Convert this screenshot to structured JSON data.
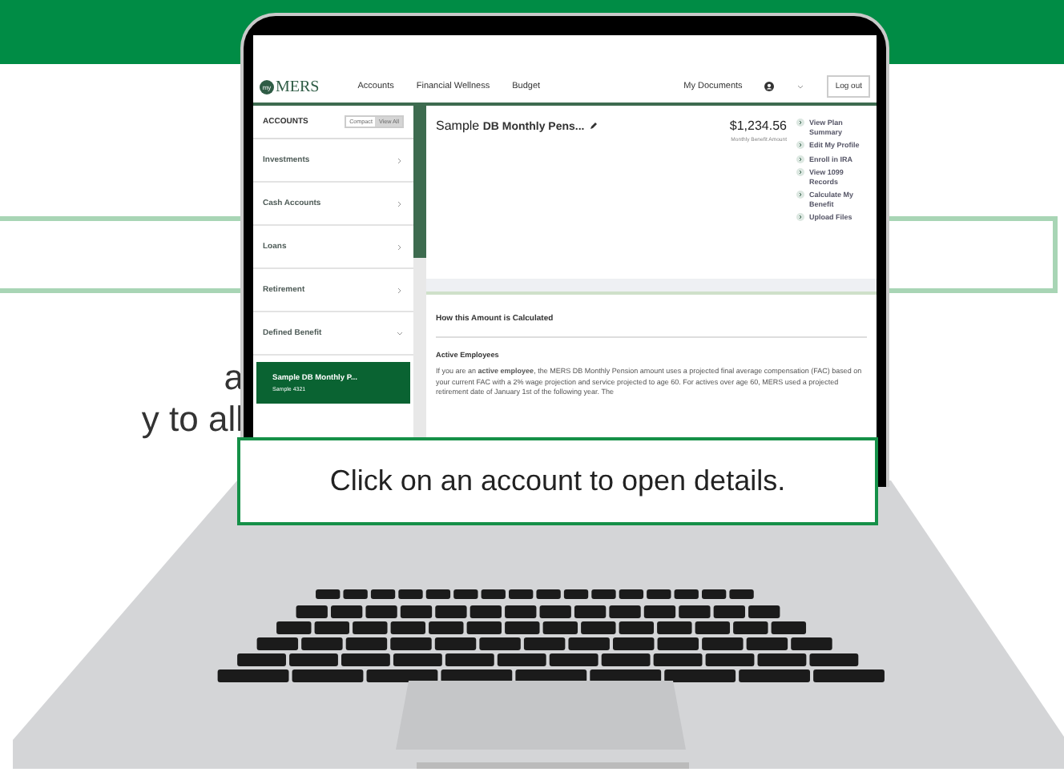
{
  "background_text": [
    "a",
    "y to all"
  ],
  "nav": {
    "logo_mark": "my",
    "logo": "MERS",
    "links": [
      "Accounts",
      "Financial Wellness",
      "Budget"
    ],
    "documents": "My Documents",
    "logout": "Log out"
  },
  "sidebar": {
    "title": "ACCOUNTS",
    "toggle": [
      {
        "label": "Compact",
        "selected": false
      },
      {
        "label": "View All",
        "selected": true
      }
    ],
    "items": [
      {
        "label": "Investments",
        "expanded": false
      },
      {
        "label": "Cash Accounts",
        "expanded": false
      },
      {
        "label": "Loans",
        "expanded": false
      },
      {
        "label": "Retirement",
        "expanded": false
      },
      {
        "label": "Defined Benefit",
        "expanded": true,
        "children": [
          {
            "label": "Sample DB Monthly P...",
            "sub": "Sample 4321",
            "selected": true
          }
        ]
      }
    ]
  },
  "account": {
    "title_prefix": "Sample",
    "title": "DB Monthly Pens...",
    "amount": "$1,234.56",
    "amount_label": "Monthly Benefit Amount",
    "actions": [
      "View Plan Summary",
      "Edit My Profile",
      "Enroll in IRA",
      "View 1099 Records",
      "Calculate My Benefit",
      "Upload Files"
    ]
  },
  "section": {
    "title": "How this Amount is Calculated",
    "subtitle": "Active Employees",
    "text": "If you are an **active employee**, the MERS DB Monthly Pension amount uses a projected final average compensation (FAC) based on your current FAC with a 2% wage projection and service projected to age 60. For actives over age 60, MERS used a projected retirement date of January 1st of the following year. The"
  },
  "callout": "Click on an account to open details."
}
